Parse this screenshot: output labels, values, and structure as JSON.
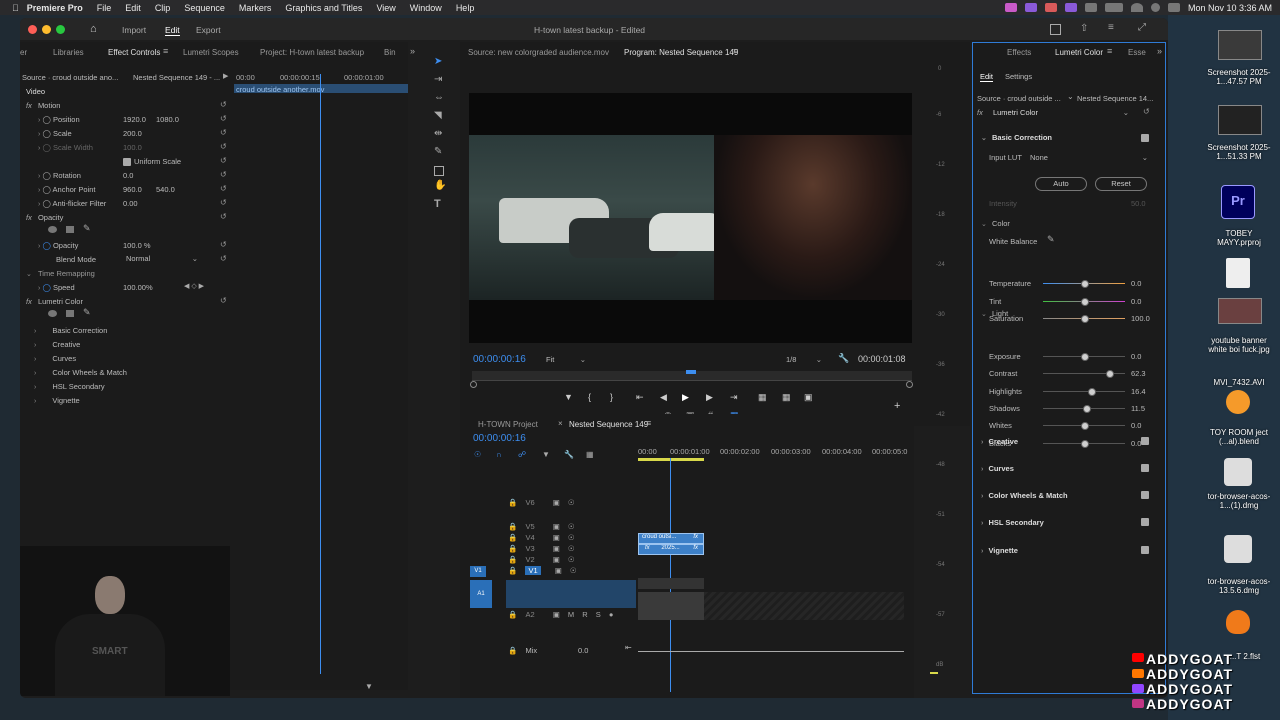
{
  "menubar": {
    "app_name": "Premiere Pro",
    "items": [
      "File",
      "Edit",
      "Clip",
      "Sequence",
      "Markers",
      "Graphics and Titles",
      "View",
      "Window",
      "Help"
    ],
    "clock": "Mon Nov 10  3:36 AM"
  },
  "window": {
    "title": "H-town latest backup - Edited",
    "workspaces": [
      "Import",
      "Edit",
      "Export"
    ],
    "active_workspace": "Edit"
  },
  "left_tabs": [
    "er",
    "Libraries",
    "Effect Controls",
    "Lumetri Scopes",
    "Project: H-town latest backup",
    "Bin"
  ],
  "effect_controls": {
    "source": "Source · croud outside ano...",
    "sequence": "Nested Sequence 149 - ...",
    "ruler": [
      "00:00",
      "00:00:00:15",
      "00:00:01:00"
    ],
    "clip_name": "croud outside another.mov",
    "video_label": "Video",
    "motion": "Motion",
    "position_label": "Position",
    "position_x": "1920.0",
    "position_y": "1080.0",
    "scale_label": "Scale",
    "scale": "200.0",
    "scale_width_label": "Scale Width",
    "scale_width": "100.0",
    "uniform_scale": "Uniform Scale",
    "rotation_label": "Rotation",
    "rotation": "0.0",
    "anchor_label": "Anchor Point",
    "anchor_x": "960.0",
    "anchor_y": "540.0",
    "antiflicker_label": "Anti-flicker Filter",
    "antiflicker": "0.00",
    "opacity": "Opacity",
    "opacity_label": "Opacity",
    "opacity_value": "100.0 %",
    "blend_label": "Blend Mode",
    "blend_value": "Normal",
    "time_remap": "Time Remapping",
    "speed_label": "Speed",
    "speed": "100.00%",
    "lumetri": "Lumetri Color",
    "sections": [
      "Basic Correction",
      "Creative",
      "Curves",
      "Color Wheels & Match",
      "HSL Secondary",
      "Vignette"
    ]
  },
  "source_tab": "Source: new colorgraded audience.mov",
  "program_tab": "Program: Nested Sequence 149",
  "program": {
    "timecode": "00:00:00:16",
    "fit": "Fit",
    "resolution": "1/8",
    "duration": "00:00:01:08"
  },
  "timeline": {
    "tabs": [
      "H-TOWN Project",
      "Nested Sequence 149"
    ],
    "timecode": "00:00:00:16",
    "ruler": [
      "00:00",
      "00:00:01:00",
      "00:00:02:00",
      "00:00:03:00",
      "00:00:04:00",
      "00:00:05:0"
    ],
    "video_tracks": [
      "V6",
      "V5",
      "V4",
      "V3",
      "V2",
      "V1"
    ],
    "audio_tracks": [
      "A1",
      "A2"
    ],
    "source_v1": "V1",
    "source_a1": "A1",
    "mix_label": "Mix",
    "mix_value": "0.0",
    "clip_v5": "croud outsi...",
    "clip_v4": "2025...",
    "fx": "fx"
  },
  "meter_scale": [
    "0",
    "-6",
    "-12",
    "-18",
    "-24",
    "-30",
    "-36",
    "-42",
    "-48",
    "-51",
    "-54",
    "-57",
    "dB"
  ],
  "meter_bottom": "S S",
  "lumetri": {
    "tabs": [
      "Effects",
      "Lumetri Color",
      "Esse"
    ],
    "sub_tabs": [
      "Edit",
      "Settings"
    ],
    "source": "Source · croud outside ...",
    "sequence": "Nested Sequence 14...",
    "effect_name": "Lumetri Color",
    "basic_correction": "Basic Correction",
    "input_lut_label": "Input LUT",
    "input_lut_value": "None",
    "auto": "Auto",
    "reset": "Reset",
    "intensity_label": "Intensity",
    "intensity": "50.0",
    "color_label": "Color",
    "white_balance": "White Balance",
    "light_label": "Light",
    "sliders": [
      {
        "label": "Temperature",
        "value": "0.0",
        "fraction": 0.5
      },
      {
        "label": "Tint",
        "value": "0.0",
        "fraction": 0.5
      },
      {
        "label": "Saturation",
        "value": "100.0",
        "fraction": 0.5
      },
      {
        "label": "Exposure",
        "value": "0.0",
        "fraction": 0.5
      },
      {
        "label": "Contrast",
        "value": "62.3",
        "fraction": 0.8
      },
      {
        "label": "Highlights",
        "value": "16.4",
        "fraction": 0.58
      },
      {
        "label": "Shadows",
        "value": "11.5",
        "fraction": 0.53
      },
      {
        "label": "Whites",
        "value": "0.0",
        "fraction": 0.5
      },
      {
        "label": "Blacks",
        "value": "0.0",
        "fraction": 0.5
      }
    ],
    "sections": [
      "Creative",
      "Curves",
      "Color Wheels & Match",
      "HSL Secondary",
      "Vignette"
    ]
  },
  "desktop": {
    "items": [
      {
        "label": "Screenshot 2025-1...47.57 PM",
        "type": "screenshot"
      },
      {
        "label": "Screenshot 2025-1...51.33 PM",
        "type": "screenshot"
      },
      {
        "label": "TOBEY MAYY.prproj",
        "type": "premiere"
      },
      {
        "label": "",
        "type": "file"
      },
      {
        "label": "youtube banner white boi fuck.jpg",
        "type": "image"
      },
      {
        "label": "MVI_7432.AVI",
        "type": "video"
      },
      {
        "label": "TOY ROOM ject (...al).blend",
        "type": "blender"
      },
      {
        "label": "tor-browser-acos-1...(1).dmg",
        "type": "dmg"
      },
      {
        "label": "tor-browser-acos-13.5.6.dmg",
        "type": "dmg"
      },
      {
        "label": "...T 2.flst",
        "type": "fl"
      }
    ],
    "watermark": [
      "ADDYGOAT",
      "ADDYGOAT",
      "ADDYGOAT",
      "ADDYGOAT"
    ],
    "smart_shirt": "SMART"
  },
  "colors": {
    "accent": "#3d8ef0",
    "panel_border": "#2f7bd6",
    "clip": "#3d80c8"
  }
}
